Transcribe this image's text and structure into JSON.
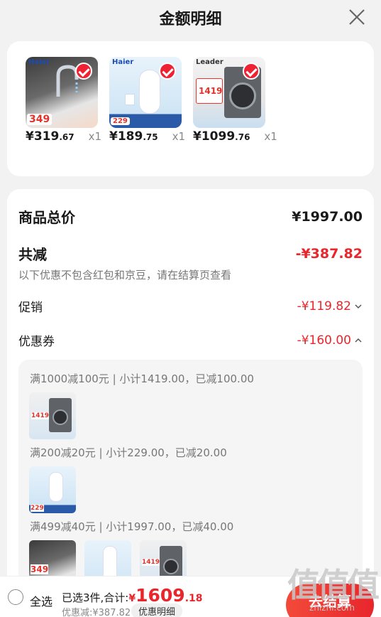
{
  "header": {
    "title": "金额明细"
  },
  "products": [
    {
      "brand": "Haier",
      "tag": "349",
      "price_main": "¥319",
      "price_cents": ".67",
      "qty": "x1"
    },
    {
      "brand": "Haier",
      "tag": "229",
      "price_main": "¥189",
      "price_cents": ".75",
      "qty": "x1"
    },
    {
      "brand": "Leader",
      "tag": "1419",
      "price_main": "¥1099",
      "price_cents": ".76",
      "qty": "x1"
    }
  ],
  "summary": {
    "total_label": "商品总价",
    "total_value": "¥1997.00",
    "reduce_label": "共减",
    "reduce_value": "-¥387.82",
    "note": "以下优惠不包含红包和京豆，请在结算页查看",
    "promo_label": "促销",
    "promo_value": "-¥119.82",
    "coupon_label": "优惠券",
    "coupon_value": "-¥160.00"
  },
  "coupons": [
    {
      "title": "满1000减100元 | 小计1419.00，已减100.00",
      "thumbs": [
        {
          "tag": "1419"
        }
      ]
    },
    {
      "title": "满200减20元 | 小计229.00，已减20.00",
      "thumbs": [
        {
          "tag": "229"
        }
      ]
    },
    {
      "title": "满499减40元 | 小计1997.00，已减40.00",
      "thumbs": [
        {
          "tag": "349"
        },
        {
          "tag": ""
        },
        {
          "tag": "1419"
        }
      ]
    }
  ],
  "bottom": {
    "select_all": "全选",
    "selected_text": "已选3件,合计:",
    "total_yen": "¥",
    "total_main": "1609",
    "total_cents": ".18",
    "discount": "优惠减:¥387.82",
    "detail_button": "优惠明细",
    "checkout": "去结算"
  },
  "watermark": {
    "big": "值值值",
    "small": "zhizhi.com"
  },
  "colors": {
    "accent_red": "#e8262c",
    "background": "#f2f2f2"
  }
}
